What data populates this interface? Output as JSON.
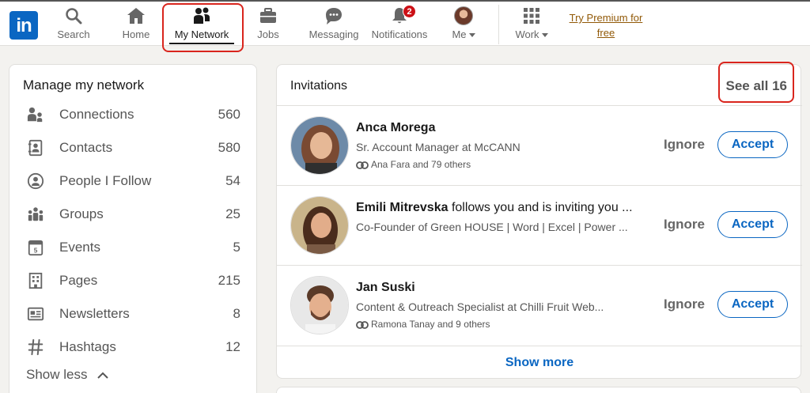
{
  "nav": {
    "logo": "in",
    "items": [
      {
        "label": "Search",
        "icon": "search-icon"
      },
      {
        "label": "Home",
        "icon": "home-icon"
      },
      {
        "label": "My Network",
        "icon": "network-icon",
        "active": true
      },
      {
        "label": "Jobs",
        "icon": "briefcase-icon"
      },
      {
        "label": "Messaging",
        "icon": "chat-icon"
      },
      {
        "label": "Notifications",
        "icon": "bell-icon",
        "badge": "2"
      },
      {
        "label": "Me",
        "icon": "avatar"
      },
      {
        "label": "Work",
        "icon": "grid-icon"
      }
    ],
    "premium_line1": "Try Premium for",
    "premium_line2": "free"
  },
  "sidebar": {
    "title": "Manage my network",
    "items": [
      {
        "label": "Connections",
        "count": "560",
        "icon": "connections-icon"
      },
      {
        "label": "Contacts",
        "count": "580",
        "icon": "contacts-icon"
      },
      {
        "label": "People I Follow",
        "count": "54",
        "icon": "person-follow-icon"
      },
      {
        "label": "Groups",
        "count": "25",
        "icon": "groups-icon"
      },
      {
        "label": "Events",
        "count": "5",
        "icon": "calendar-icon"
      },
      {
        "label": "Pages",
        "count": "215",
        "icon": "building-icon"
      },
      {
        "label": "Newsletters",
        "count": "8",
        "icon": "newsletter-icon"
      },
      {
        "label": "Hashtags",
        "count": "12",
        "icon": "hashtag-icon"
      }
    ],
    "show_less": "Show less"
  },
  "invitations": {
    "title": "Invitations",
    "see_all": "See all 16",
    "items": [
      {
        "name": "Anca Morega",
        "suffix": "",
        "headline": "Sr. Account Manager at McCANN",
        "mutual": "Ana Fara and 79 others"
      },
      {
        "name": "Emili Mitrevska",
        "suffix": " follows you and is inviting you ...",
        "headline": "Co-Founder of Green HOUSE | Word | Excel | Power ...",
        "mutual": ""
      },
      {
        "name": "Jan Suski",
        "suffix": "",
        "headline": "Content & Outreach Specialist at Chilli Fruit Web...",
        "mutual": "Ramona Tanay and 9 others"
      }
    ],
    "ignore_label": "Ignore",
    "accept_label": "Accept",
    "show_more": "Show more"
  },
  "colors": {
    "brand": "#0a66c2",
    "highlight": "#d9251d",
    "badge": "#cc1016",
    "premium": "#915907"
  }
}
